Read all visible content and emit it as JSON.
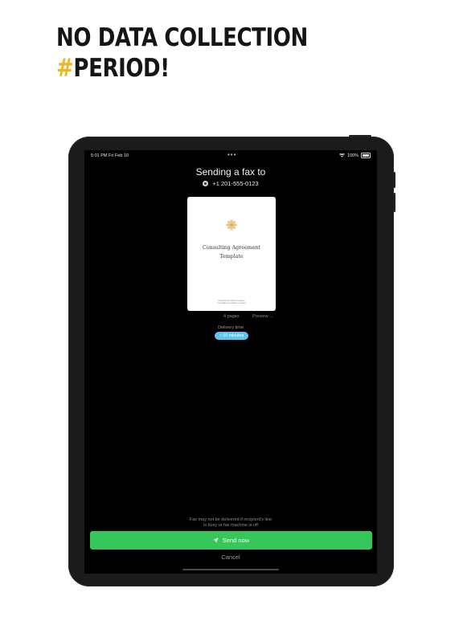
{
  "headline": {
    "line1": "NO DATA COLLECTION",
    "hash": "#",
    "line2": "PERIOD!"
  },
  "status_bar": {
    "time": "5:01 PM   Fri Feb 10",
    "dots": "•••",
    "battery": "100%"
  },
  "screen": {
    "title": "Sending a fax to",
    "recipient": "+1 201-555-0123",
    "document": {
      "title_line1": "Consulting Agreement",
      "title_line2": "Template",
      "fine_print_line1": "Prepared for Client company",
      "fine_print_line2": "Consultant and Client company"
    },
    "page_count": "4 pages",
    "preview_label": "Preview →",
    "delivery_label": "Delivery time",
    "delivery_value": "~ 10 minutes",
    "notice_line1": "Fax may not be delivered if recipient's line",
    "notice_line2": "is busy or fax machine is off",
    "send_label": "Send now",
    "cancel_label": "Cancel"
  },
  "colors": {
    "accent_green": "#35c759",
    "chip_blue": "#5fc4f2",
    "hash_yellow": "#f0b323"
  },
  "icons": [
    "avatar-icon",
    "wifi-icon",
    "battery-icon",
    "flower-logo-icon",
    "send-icon"
  ]
}
